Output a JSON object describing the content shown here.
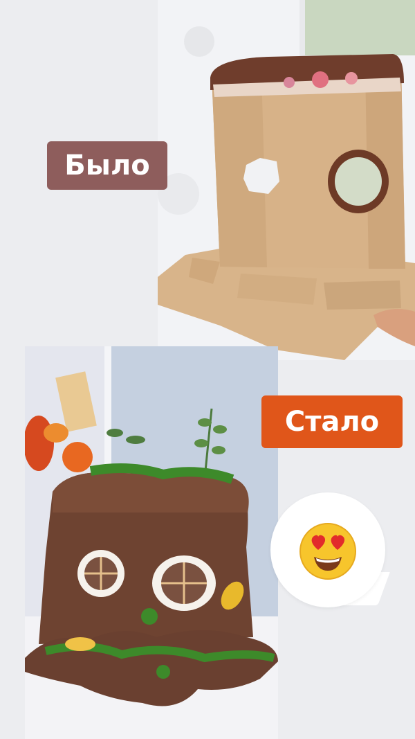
{
  "labels": {
    "before": "Было",
    "after": "Стало"
  },
  "emoji": "heart-eyes-face",
  "colors": {
    "background": "#ecedf0",
    "before_label_bg": "#8e5d5c",
    "after_label_bg": "#e0561a",
    "label_text": "#ffffff"
  }
}
